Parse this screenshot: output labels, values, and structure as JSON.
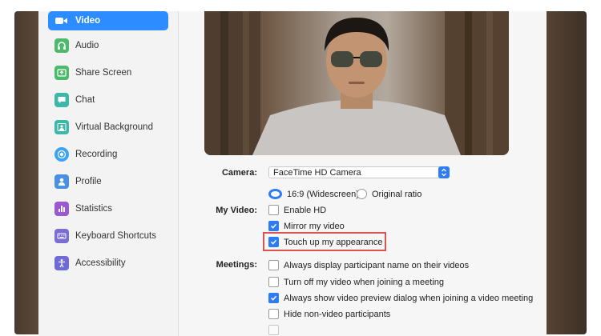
{
  "sidebar": {
    "items": [
      {
        "label": "Video",
        "icon": "video-camera-icon",
        "color": "#ffffff",
        "active": true
      },
      {
        "label": "Audio",
        "icon": "headphones-icon",
        "color": "#4cb96b"
      },
      {
        "label": "Share Screen",
        "icon": "share-screen-icon",
        "color": "#4cb96b"
      },
      {
        "label": "Chat",
        "icon": "chat-icon",
        "color": "#3db8a8"
      },
      {
        "label": "Virtual Background",
        "icon": "person-background-icon",
        "color": "#3db8a8"
      },
      {
        "label": "Recording",
        "icon": "record-icon",
        "color": "#3aa3f2"
      },
      {
        "label": "Profile",
        "icon": "profile-icon",
        "color": "#4a90e2"
      },
      {
        "label": "Statistics",
        "icon": "statistics-icon",
        "color": "#9b59d0"
      },
      {
        "label": "Keyboard Shortcuts",
        "icon": "keyboard-icon",
        "color": "#7a6fd1"
      },
      {
        "label": "Accessibility",
        "icon": "accessibility-icon",
        "color": "#6e6bd6"
      }
    ],
    "active_color": "#2d8cff"
  },
  "video": {
    "camera_label": "Camera:",
    "camera_value": "FaceTime HD Camera",
    "ratio_widescreen": "16:9 (Widescreen)",
    "ratio_original": "Original ratio",
    "my_video_label": "My Video:",
    "enable_hd": "Enable HD",
    "mirror": "Mirror my video",
    "touch_up": "Touch up my appearance",
    "meetings_label": "Meetings:",
    "always_display_name": "Always display participant name on their videos",
    "turn_off_video": "Turn off my video when joining a meeting",
    "always_show_preview": "Always show video preview dialog when joining a video meeting",
    "hide_non_video": "Hide non-video participants"
  }
}
